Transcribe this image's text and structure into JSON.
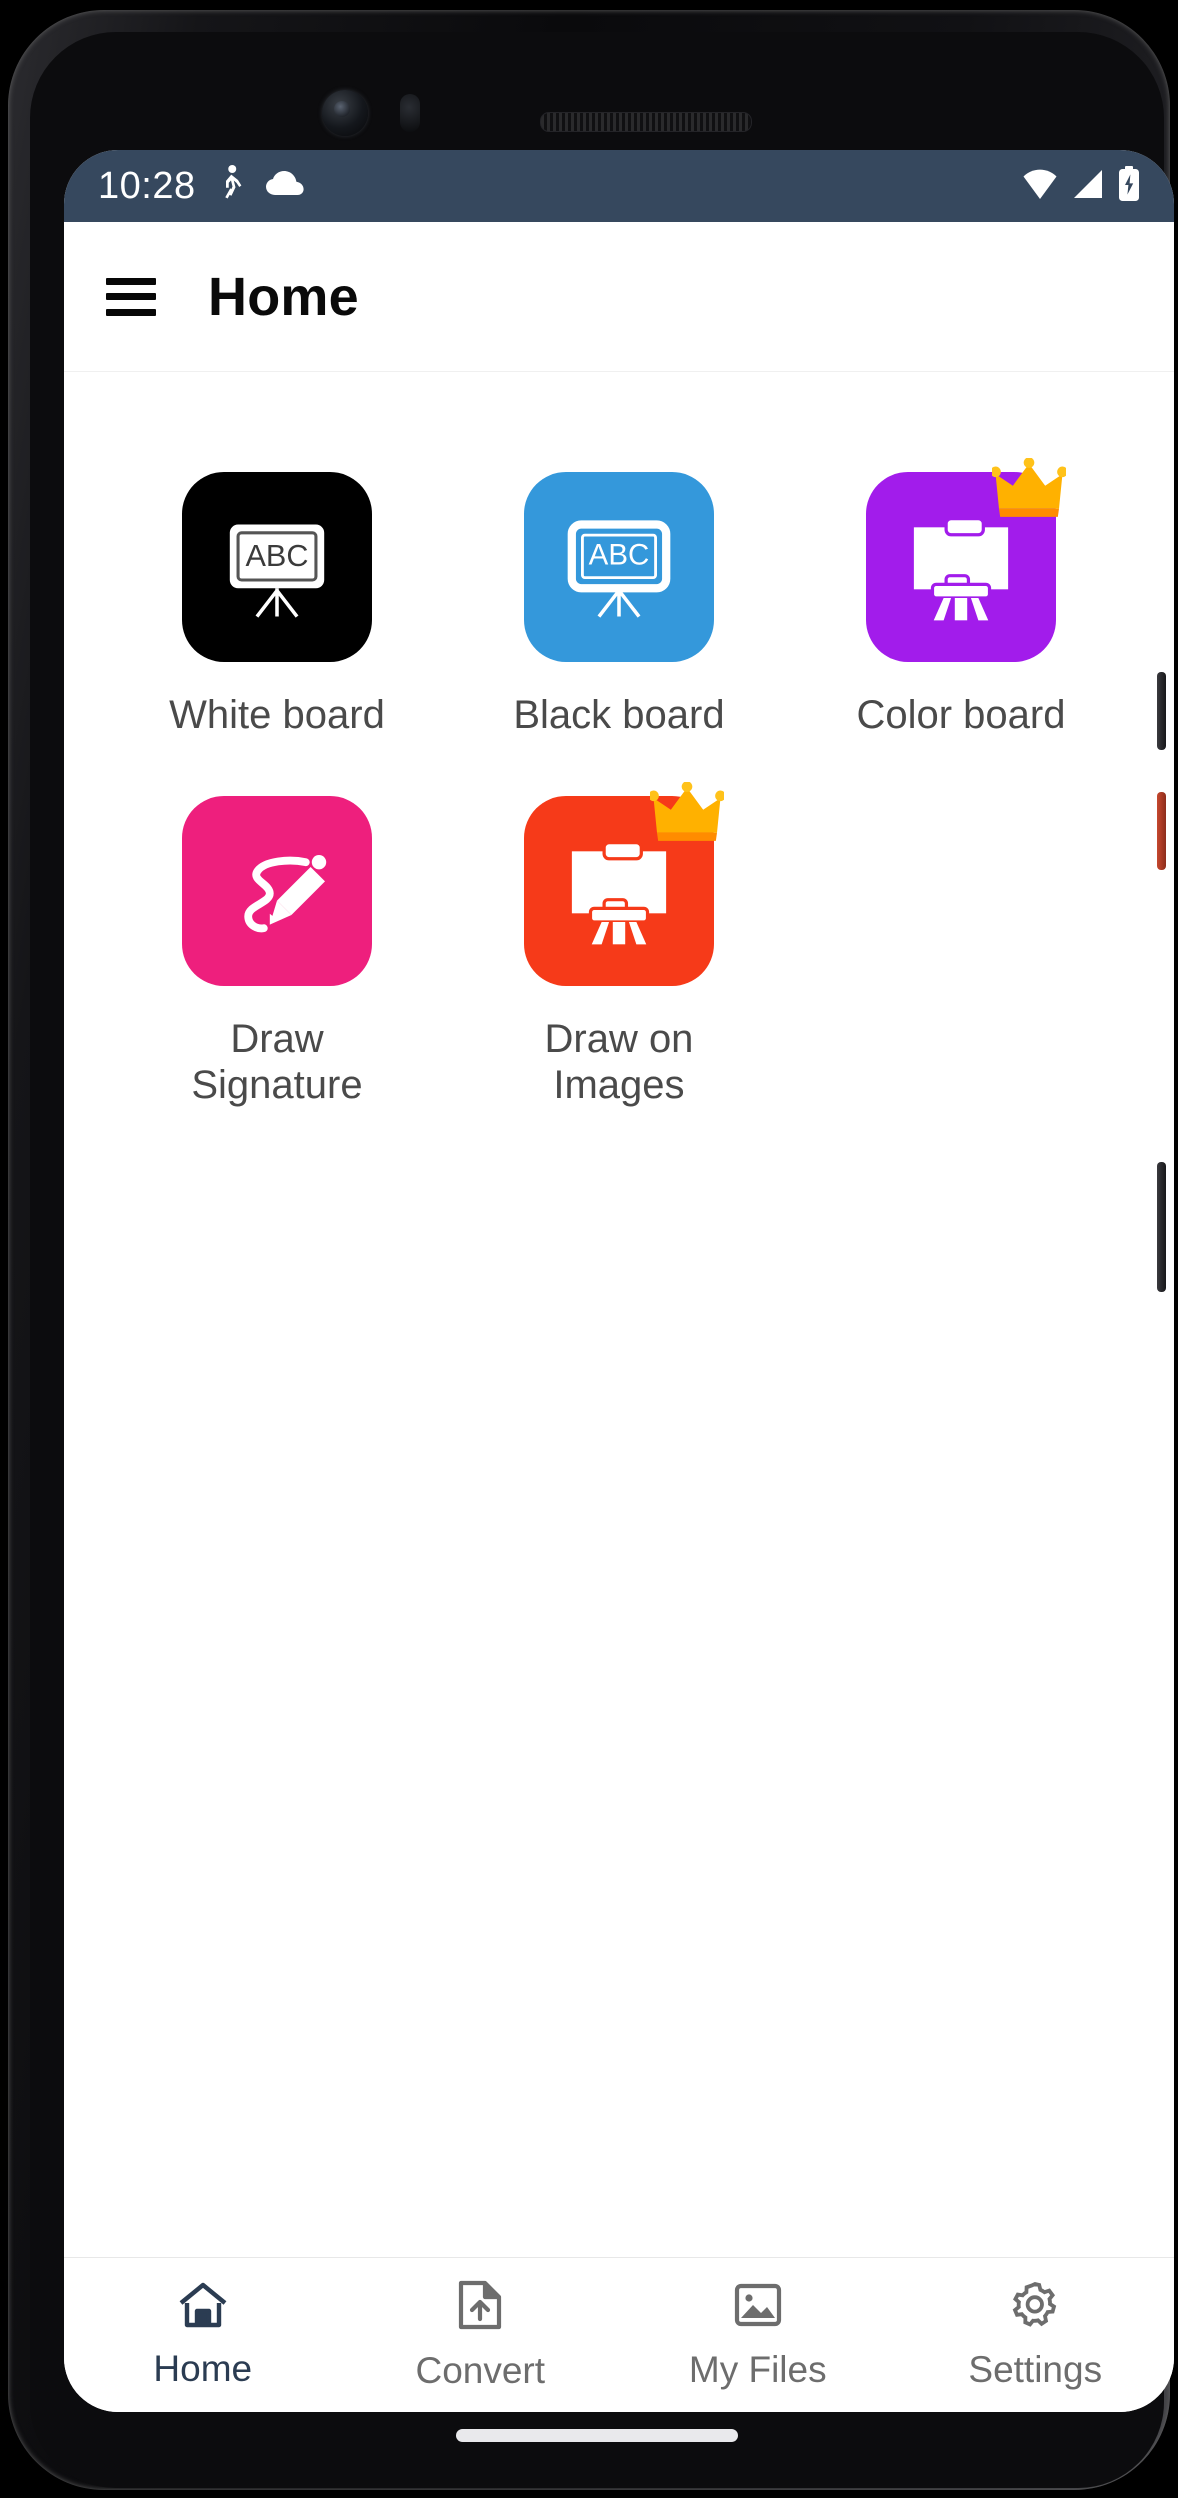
{
  "statusbar": {
    "time": "10:28",
    "left_icons": [
      "walking-person-icon",
      "cloud-icon"
    ],
    "right_icons": [
      "wifi-icon",
      "signal-icon",
      "battery-charging-icon"
    ],
    "background_color": "#36485e"
  },
  "appbar": {
    "menu_icon": "hamburger-menu-icon",
    "title": "Home"
  },
  "tools": [
    {
      "label": "White board",
      "icon": "abc-easel-icon",
      "tile_color": "#000000",
      "glyph_color": "#ffffff",
      "premium": false
    },
    {
      "label": "Black board",
      "icon": "abc-easel-icon",
      "tile_color": "#3498db",
      "glyph_color": "#ffffff",
      "premium": false
    },
    {
      "label": "Color board",
      "icon": "canvas-easel-icon",
      "tile_color": "#a21ceb",
      "glyph_color": "#ffffff",
      "premium": true
    },
    {
      "label": "Draw Signature",
      "icon": "pen-signature-icon",
      "tile_color": "#ee1f7d",
      "glyph_color": "#ffffff",
      "premium": false
    },
    {
      "label": "Draw on Images",
      "icon": "canvas-easel-icon",
      "tile_color": "#f63a19",
      "glyph_color": "#ffffff",
      "premium": true
    }
  ],
  "board_text": "ABC",
  "crown_colors": {
    "top": "#ffc21a",
    "bottom": "#ff8c00"
  },
  "bottomnav": {
    "active_color": "#2b3c52",
    "inactive_color": "#6d6d6d",
    "items": [
      {
        "label": "Home",
        "icon": "home-icon",
        "active": true
      },
      {
        "label": "Convert",
        "icon": "file-upload-icon",
        "active": false
      },
      {
        "label": "My Files",
        "icon": "image-icon",
        "active": false
      },
      {
        "label": "Settings",
        "icon": "gear-icon",
        "active": false
      }
    ]
  }
}
